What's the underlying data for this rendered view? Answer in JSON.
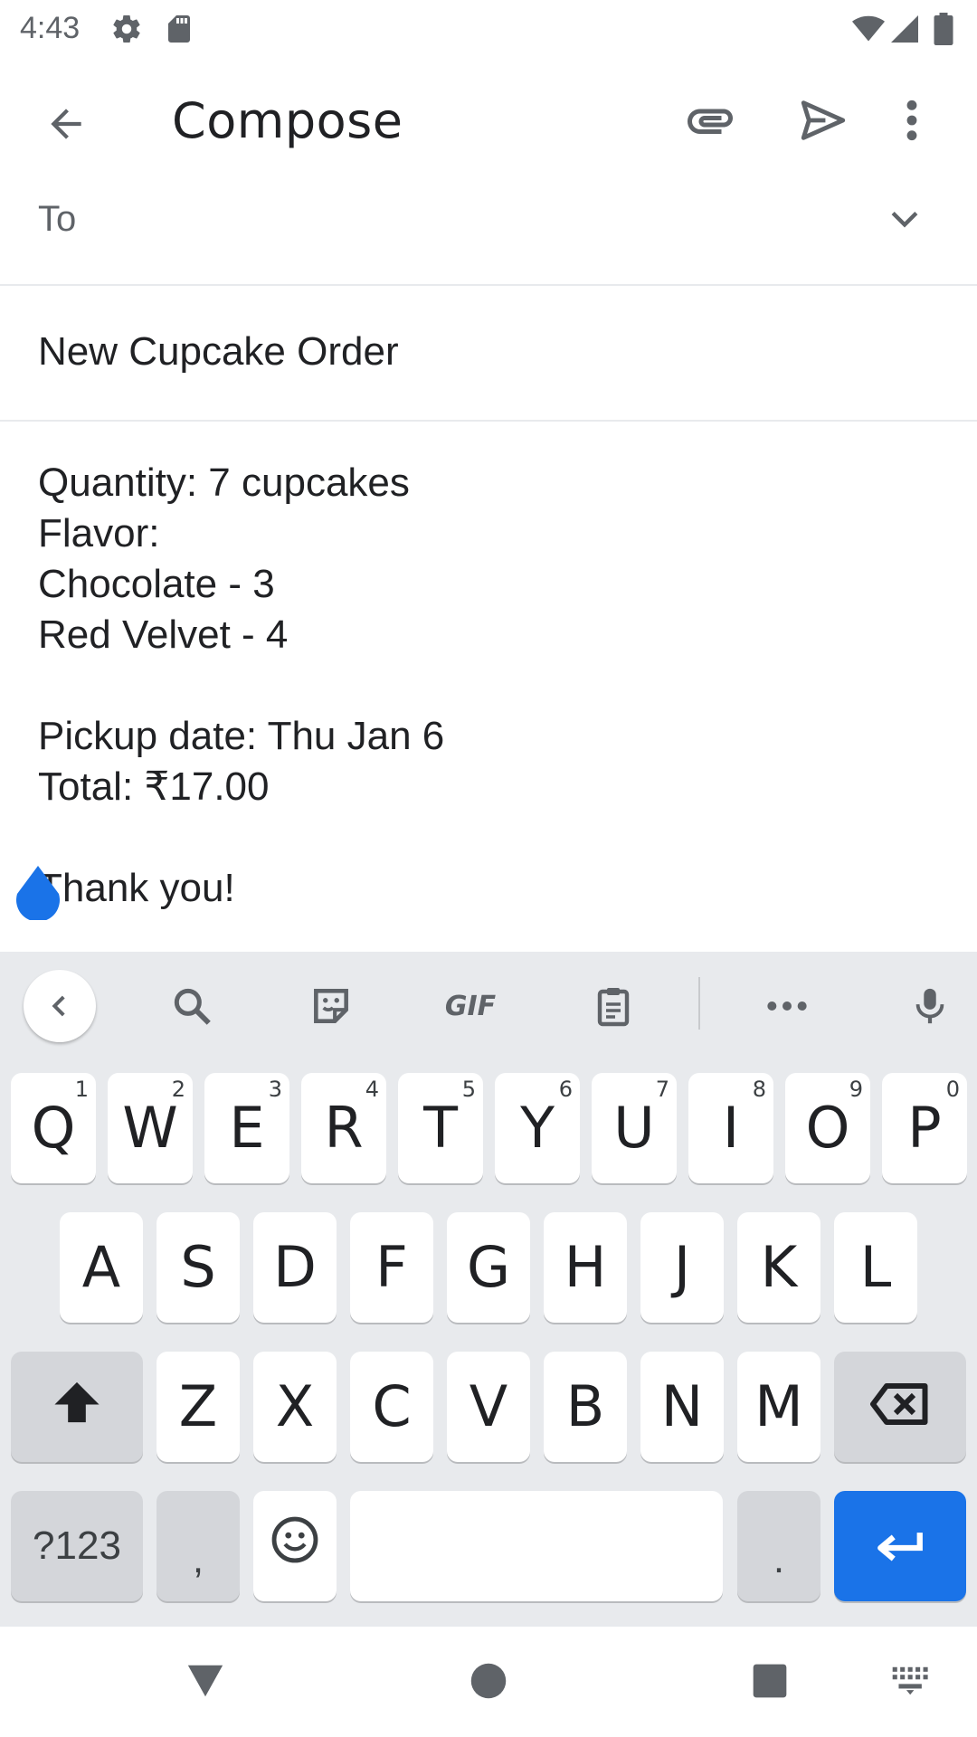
{
  "status_bar": {
    "time": "4:43",
    "icons": [
      "settings-icon",
      "sd-card-icon",
      "wifi-icon",
      "signal-icon",
      "battery-icon"
    ]
  },
  "app_bar": {
    "title": "Compose",
    "icons": [
      "back-arrow-icon",
      "attach-icon",
      "send-icon",
      "more-vert-icon"
    ]
  },
  "to_field": {
    "label": "To",
    "icon": "chevron-down-icon"
  },
  "subject": {
    "value": "New Cupcake Order"
  },
  "body": {
    "lines": [
      "Quantity: 7 cupcakes",
      "Flavor:",
      "Chocolate - 3",
      "Red Velvet - 4",
      "",
      "Pickup date: Thu Jan 6",
      "Total: ₹17.00",
      "",
      "Thank you!"
    ]
  },
  "keyboard": {
    "toolbar_icons": [
      "back-chevron-icon",
      "search-icon",
      "sticker-icon",
      "gif-icon",
      "clipboard-icon",
      "more-horiz-icon",
      "mic-icon"
    ],
    "gif_label": "GIF",
    "row1": [
      {
        "label": "Q",
        "hint": "1"
      },
      {
        "label": "W",
        "hint": "2"
      },
      {
        "label": "E",
        "hint": "3"
      },
      {
        "label": "R",
        "hint": "4"
      },
      {
        "label": "T",
        "hint": "5"
      },
      {
        "label": "Y",
        "hint": "6"
      },
      {
        "label": "U",
        "hint": "7"
      },
      {
        "label": "I",
        "hint": "8"
      },
      {
        "label": "O",
        "hint": "9"
      },
      {
        "label": "P",
        "hint": "0"
      }
    ],
    "row2": [
      "A",
      "S",
      "D",
      "F",
      "G",
      "H",
      "J",
      "K",
      "L"
    ],
    "row3": [
      "Z",
      "X",
      "C",
      "V",
      "B",
      "N",
      "M"
    ],
    "symbols_label": "?123",
    "comma_label": ",",
    "period_label": ".",
    "accent_color": "#1a73e8"
  },
  "nav_bar": {
    "icons": [
      "back-triangle-icon",
      "home-circle-icon",
      "recents-square-icon",
      "keyboard-switch-icon"
    ]
  }
}
